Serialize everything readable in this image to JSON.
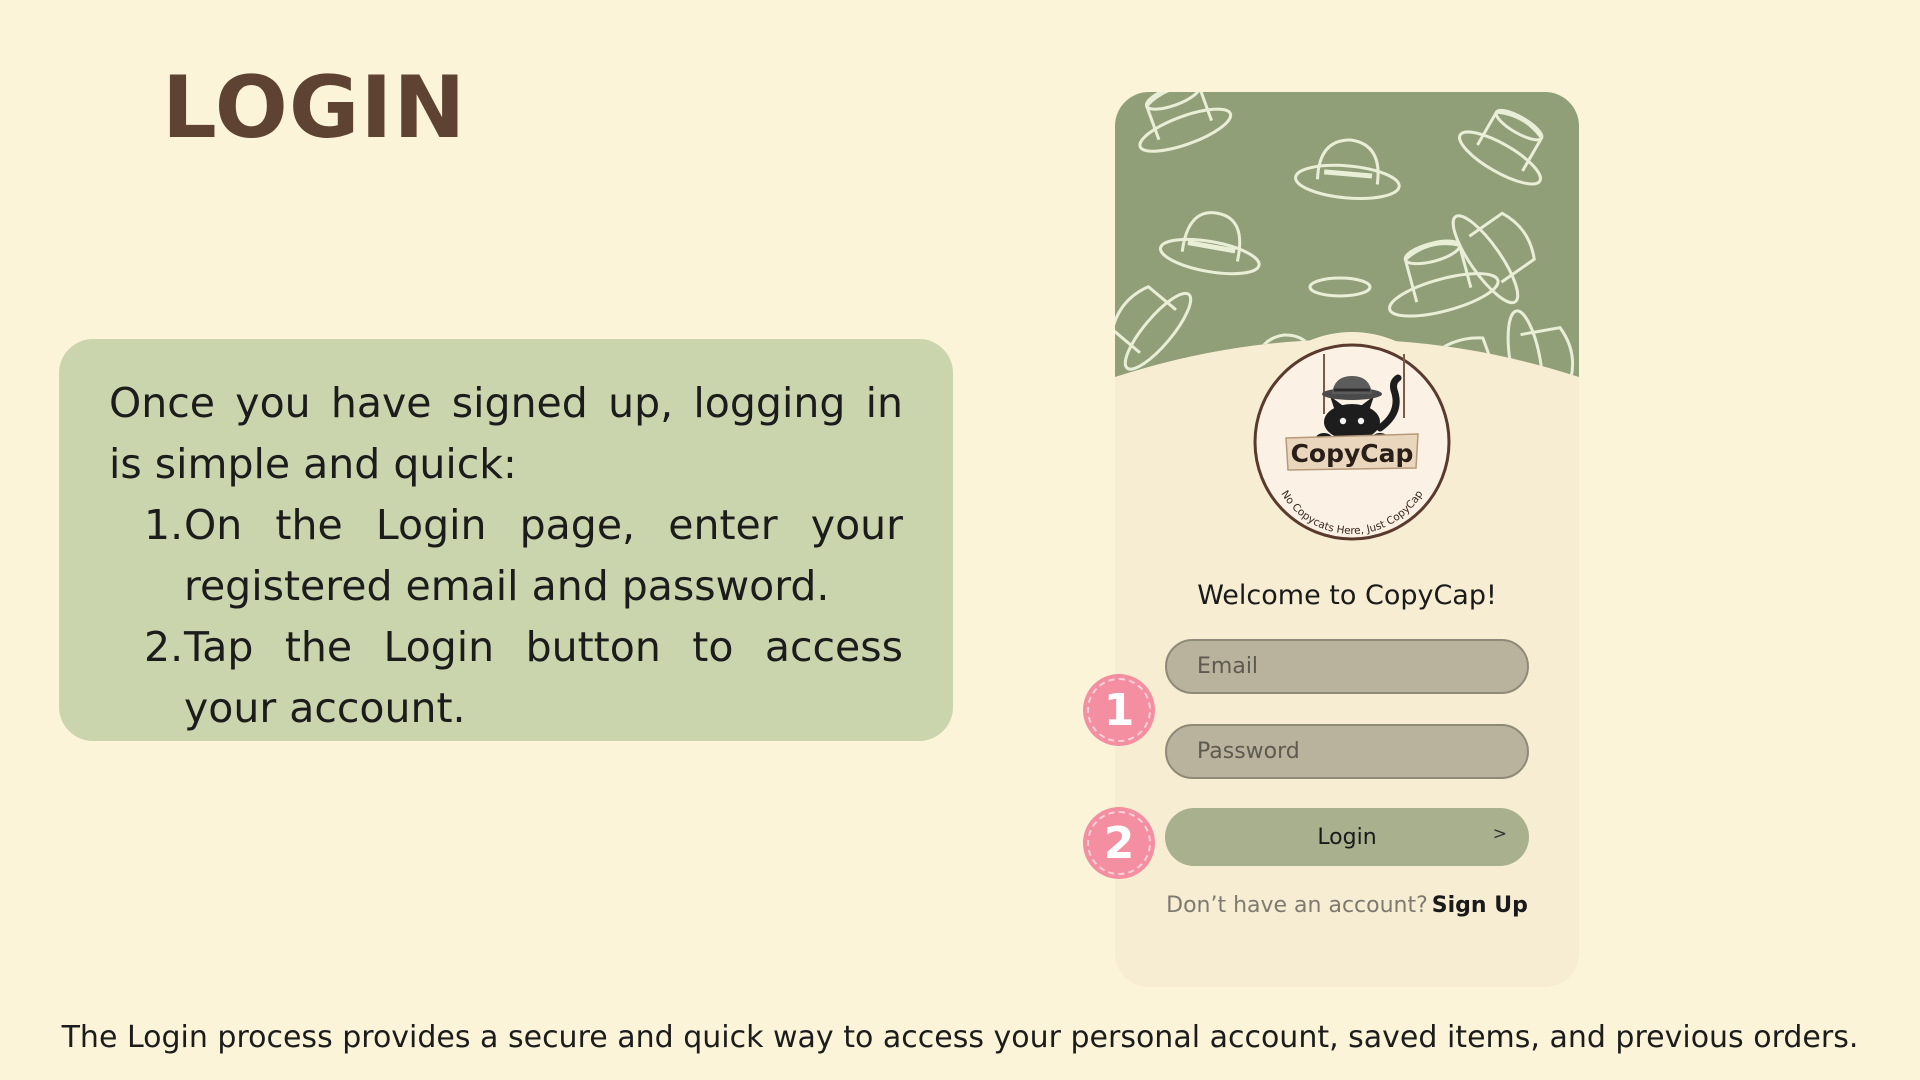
{
  "page": {
    "title": "LOGIN",
    "caption": "The Login process provides a secure and quick way to access your personal account, saved items, and previous orders."
  },
  "instructions": {
    "intro": "Once you have signed up, logging in is simple and quick:",
    "steps": [
      {
        "num": "1.",
        "text": "On the Login page, enter your registered email and password."
      },
      {
        "num": "2.",
        "text": "Tap the Login button to access your account."
      }
    ]
  },
  "app": {
    "logo_text": "CopyCap",
    "logo_tagline": "No Copycats Here, Just CopyCap",
    "welcome": "Welcome to CopyCap!",
    "email_placeholder": "Email",
    "password_placeholder": "Password",
    "login_label": "Login",
    "login_chevron": ">",
    "signup_prompt": "Don’t have an account?",
    "signup_link": "Sign Up"
  },
  "callouts": {
    "badge_1": "1",
    "badge_2": "2"
  },
  "colors": {
    "background": "#fbf4d8",
    "card": "#cbd5ad",
    "title": "#5e4232",
    "hat_pattern": "#919f78",
    "badge": "#f38fa0",
    "login_button": "#a8b08e",
    "input": "#b9b29c"
  }
}
